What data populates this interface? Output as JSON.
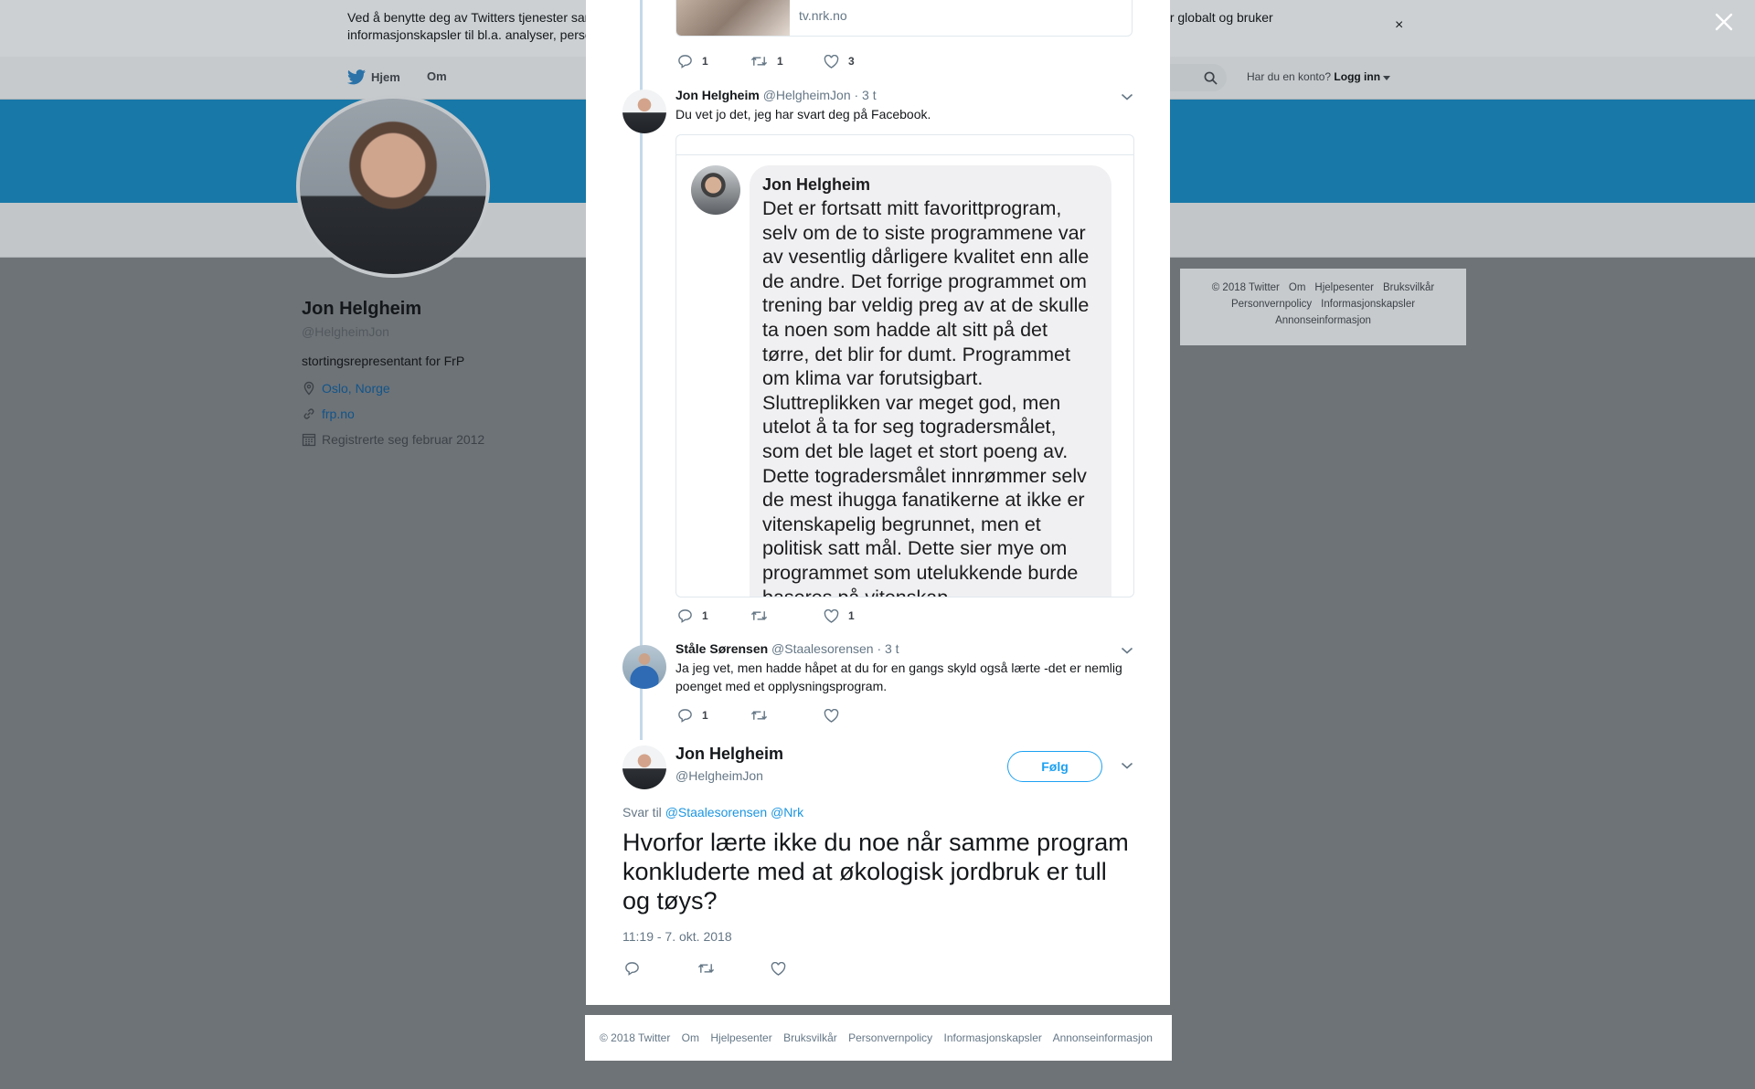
{
  "cookie_bar": {
    "text": "Ved å benytte deg av Twitters tjenester samtykker du i vår bruk av informasjonskapsler og dataoverføring utenfor EU. Vi og våre partnere opererer globalt og bruker informasjonskapsler til bl.a. analyser, personalisering og annonser.",
    "close": "×"
  },
  "nav": {
    "home": "Hjem",
    "about": "Om",
    "login_prompt": "Har du en konto?",
    "login": "Logg inn"
  },
  "profile": {
    "name": "Jon Helgheim",
    "handle": "@HelgheimJon",
    "bio": "stortingsrepresentant for FrP",
    "location": "Oslo, Norge",
    "url": "frp.no",
    "joined": "Registrerte seg februar 2012"
  },
  "side_footer": [
    "© 2018 Twitter",
    "Om",
    "Hjelpesenter",
    "Bruksvilkår",
    "Personvernpolicy",
    "Informasjonskapsler",
    "Annonseinformasjon"
  ],
  "modal": {
    "link_card_domain": "tv.nrk.no",
    "tweet0_actions": {
      "replies": "1",
      "retweets": "1",
      "likes": "3"
    },
    "tweet1": {
      "name": "Jon Helgheim",
      "handle": "@HelgheimJon",
      "time": "· 3 t",
      "text": "Du vet jo det, jeg har svart deg på Facebook.",
      "embed_name": "Jon Helgheim",
      "embed_body": "Det er fortsatt mitt favorittprogram, selv om de to siste programmene var av vesentlig dårligere kvalitet enn alle de andre. Det forrige programmet om trening bar veldig preg av at de skulle ta noen som hadde alt sitt på det tørre, det blir for dumt. Programmet om klima var forutsigbart. Sluttreplikken var meget god, men utelot å ta for seg togradersmålet, som det ble laget et stort poeng av. Dette togradersmålet innrømmer selv de mest ihugga fanatikerne at ikke er vitenskapelig begrunnet, men et politisk satt mål. Dette sier mye om programmet som utelukkende burde baseres på vitenskap.",
      "actions": {
        "replies": "1",
        "retweets": "",
        "likes": "1"
      }
    },
    "tweet2": {
      "name": "Ståle Sørensen",
      "handle": "@Staalesorensen",
      "time": "· 3 t",
      "text": "Ja jeg vet, men hadde håpet at du for en gangs skyld også lærte -det er nemlig poenget med et opplysningsprogram.",
      "actions": {
        "replies": "1",
        "retweets": "",
        "likes": ""
      }
    },
    "focus": {
      "name": "Jon Helgheim",
      "handle": "@HelgheimJon",
      "follow": "Følg",
      "reply_prefix": "Svar til",
      "reply_mentions": "@Staalesorensen @Nrk",
      "text": "Hvorfor lærte ikke du noe når samme program konkluderte med at økologisk jordbruk er tull og tøys?",
      "timestamp": "11:19 - 7. okt. 2018"
    }
  },
  "bottom_footer": [
    "© 2018 Twitter",
    "Om",
    "Hjelpesenter",
    "Bruksvilkår",
    "Personvernpolicy",
    "Informasjonskapsler",
    "Annonseinformasjon"
  ],
  "colors": {
    "accent": "#1da1f2",
    "banner": "#1878a8",
    "overlay": "#6e7377"
  }
}
